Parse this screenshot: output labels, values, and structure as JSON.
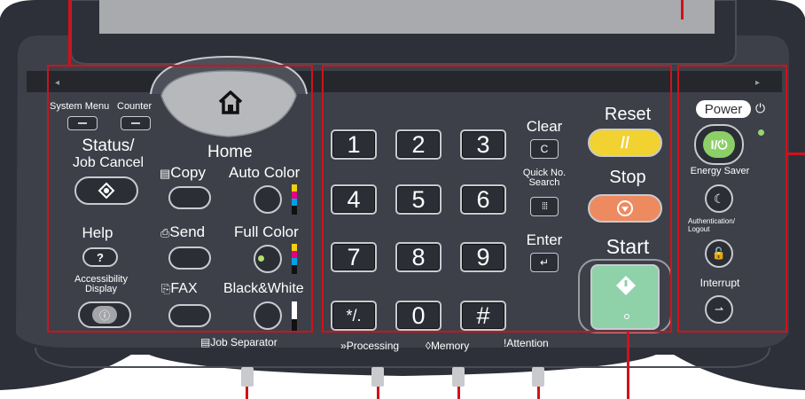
{
  "left": {
    "system_menu": "System Menu",
    "counter": "Counter",
    "status_line1": "Status/",
    "status_line2": "Job Cancel",
    "home": "Home",
    "copy": "Copy",
    "send": "Send",
    "fax": "FAX",
    "auto_color": "Auto Color",
    "full_color": "Full Color",
    "black_white": "Black&White",
    "help": "Help",
    "help_symbol": "?",
    "accessibility_line1": "Accessibility",
    "accessibility_line2": "Display"
  },
  "keypad": {
    "keys": [
      "1",
      "2",
      "3",
      "4",
      "5",
      "6",
      "7",
      "8",
      "9",
      "*/.",
      "0",
      "#"
    ],
    "clear": "Clear",
    "clear_key": "C",
    "quick_line1": "Quick No.",
    "quick_line2": "Search",
    "enter": "Enter",
    "reset": "Reset",
    "stop": "Stop",
    "start": "Start"
  },
  "right": {
    "power": "Power",
    "power_key": "I/⏻",
    "energy_saver": "Energy Saver",
    "auth_line1": "Authentication/",
    "auth_line2": "Logout",
    "interrupt": "Interrupt"
  },
  "indicators": {
    "job_separator": "Job Separator",
    "processing": "Processing",
    "memory": "Memory",
    "attention": "Attention"
  },
  "colors": {
    "panel": "#3d4049",
    "frame": "#2d3038",
    "highlight": "#d0121b",
    "reset": "#f1d231",
    "stop": "#ee8a5f",
    "start": "#8fd1a8",
    "power": "#8ccf68"
  }
}
